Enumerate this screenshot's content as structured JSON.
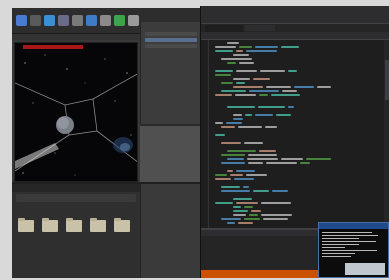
{
  "screen": {
    "background": "#d9d9d9"
  },
  "editor": {
    "toolbar": {
      "buttons": [
        {
          "name": "save-button",
          "icon": "save-icon",
          "color": "#4a7bd1"
        },
        {
          "name": "source-control-button",
          "icon": "source-control-icon",
          "color": "#5a5a5a"
        },
        {
          "name": "content-button",
          "icon": "content-icon",
          "color": "#3b8fd6"
        },
        {
          "name": "marketplace-button",
          "icon": "marketplace-icon",
          "color": "#6a6a8a"
        },
        {
          "name": "settings-button",
          "icon": "gear-icon",
          "color": "#7a7a7a"
        },
        {
          "name": "blueprints-button",
          "icon": "blueprint-icon",
          "color": "#3f7bc7"
        },
        {
          "name": "build-button",
          "icon": "build-icon",
          "color": "#8a8a8a"
        },
        {
          "name": "play-button",
          "icon": "play-icon",
          "color": "#3fa34d"
        },
        {
          "name": "launch-button",
          "icon": "launch-icon",
          "color": "#9a9a9a"
        }
      ]
    },
    "viewport": {
      "background": "#060608",
      "header_color": "#a61818"
    },
    "content_browser": {
      "folders": [
        {
          "label": ""
        },
        {
          "label": ""
        },
        {
          "label": ""
        },
        {
          "label": ""
        },
        {
          "label": ""
        }
      ]
    }
  },
  "ide": {
    "accent": "#ca5100",
    "background": "#1e1e1e",
    "code_colors": {
      "keyword": "#569cd6",
      "type": "#4ec9b0",
      "text": "#c8c8c8",
      "comment": "#57a64a",
      "string": "#d69d85"
    }
  },
  "console": {
    "title_color": "#1f4a8c",
    "background": "#0c0c0c"
  }
}
